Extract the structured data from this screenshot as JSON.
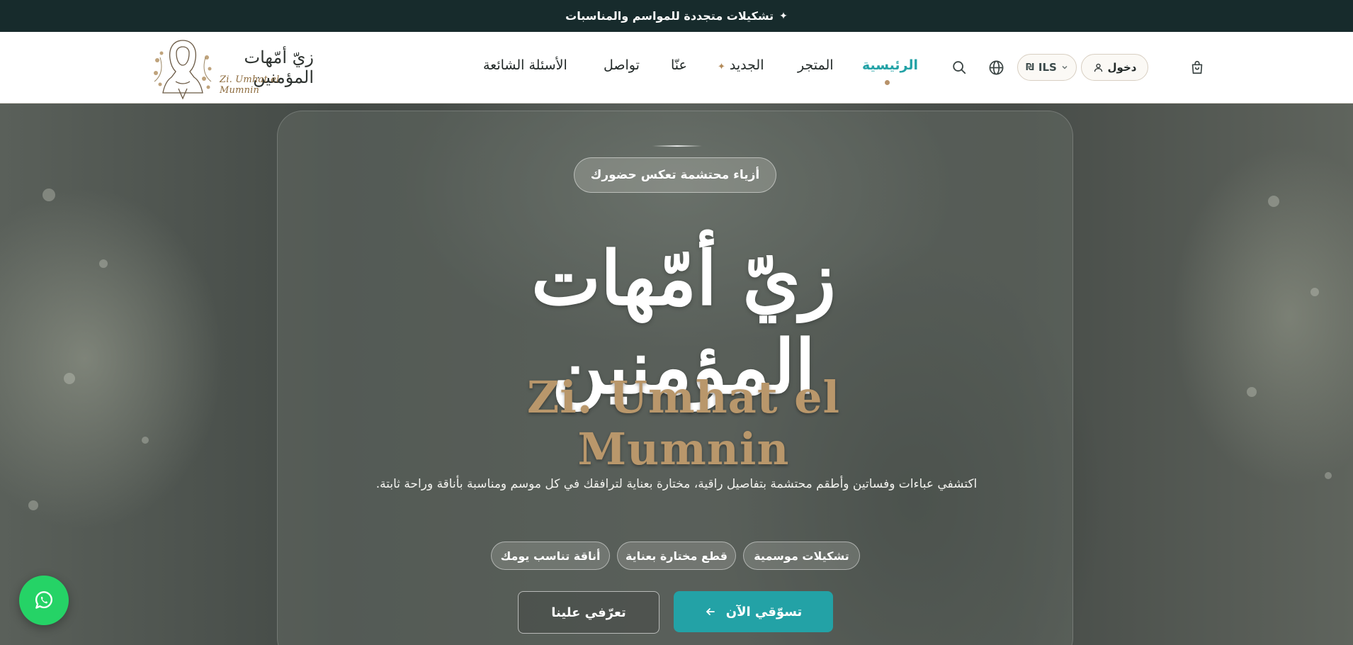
{
  "announcement": {
    "icon": "sparkle-icon",
    "text": "تشكيلات متجددة للمواسم والمناسبات"
  },
  "logo": {
    "arabic": "زيّ أمّهات المؤمنين",
    "english": "Zi. Umhat el Mumnin"
  },
  "nav": {
    "home": "الرئيسية",
    "shop": "المتجر",
    "new": "الجديد",
    "about": "عنّا",
    "contact": "تواصل",
    "faq": "الأسئلة الشائعة"
  },
  "header_actions": {
    "currency": "ILS",
    "currency_symbol": "₪",
    "login": "دخول"
  },
  "hero": {
    "tagline": "أزياء محتشمة تعكس حضورك",
    "title_ar": "زيّ أمّهات المؤمنين",
    "title_en": "Zi. Umhat el Mumnin",
    "description": "اكتشفي عباءات وفساتين وأطقم محتشمة بتفاصيل راقية، مختارة بعناية لترافقك في كل موسم ومناسبة بأناقة وراحة ثابتة.",
    "chips": [
      "تشكيلات موسمية",
      "قطع مختارة بعناية",
      "أناقة تناسب يومك"
    ],
    "primary_button": "تسوّقي الآن",
    "secondary_button": "تعرّفي علينا"
  },
  "colors": {
    "accent": "#23a2a6",
    "announcement_bg": "#172b2c",
    "gold": "#b9976b",
    "whatsapp": "#25d366"
  }
}
